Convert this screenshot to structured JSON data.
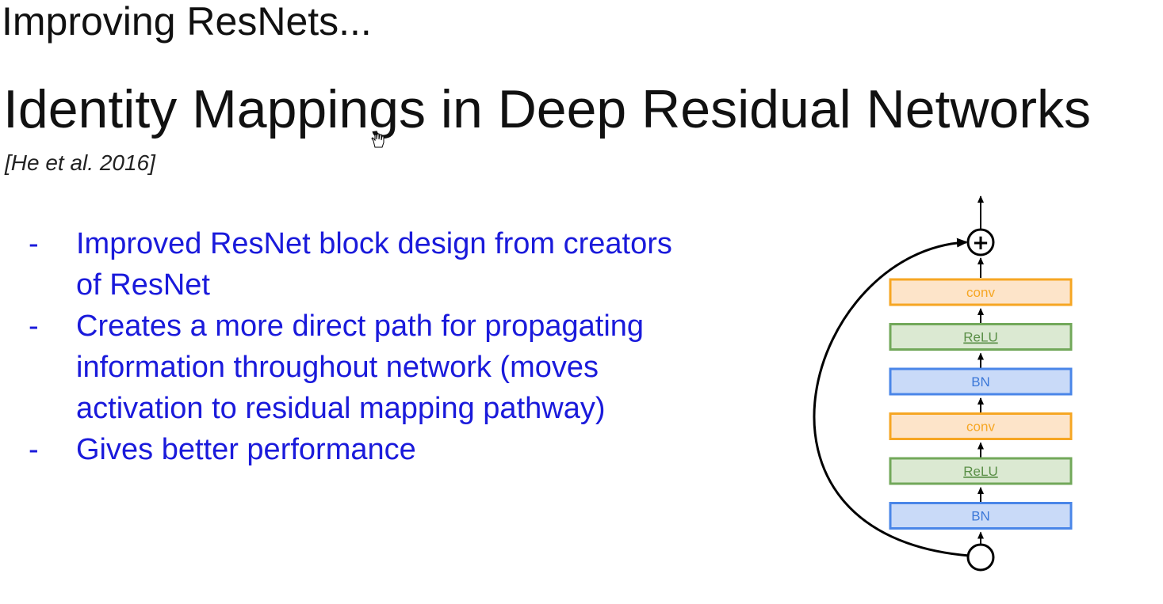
{
  "slide": {
    "section_title": "Improving ResNets...",
    "title": "Identity Mappings in Deep Residual Networks",
    "citation": "[He et al. 2016]",
    "bullet_marker": "-",
    "bullets": [
      "Improved ResNet block design from creators of ResNet",
      "Creates a more direct path for propagating information throughout network (moves activation to residual mapping pathway)",
      "Gives better performance"
    ]
  },
  "diagram": {
    "add_symbol": "+",
    "layers_top_to_bottom": [
      {
        "label": "conv",
        "kind": "conv"
      },
      {
        "label": "ReLU",
        "kind": "relu"
      },
      {
        "label": "BN",
        "kind": "bn"
      },
      {
        "label": "conv",
        "kind": "conv"
      },
      {
        "label": "ReLU",
        "kind": "relu"
      },
      {
        "label": "BN",
        "kind": "bn"
      }
    ],
    "colors": {
      "conv_fill": "#fde4c9",
      "conv_stroke": "#f6a623",
      "conv_text": "#f6a623",
      "relu_fill": "#dbe9d2",
      "relu_stroke": "#72a85a",
      "relu_text": "#5a8f47",
      "bn_fill": "#c9daf8",
      "bn_stroke": "#4a86e8",
      "bn_text": "#3c78d8",
      "arrow": "#000000"
    }
  }
}
